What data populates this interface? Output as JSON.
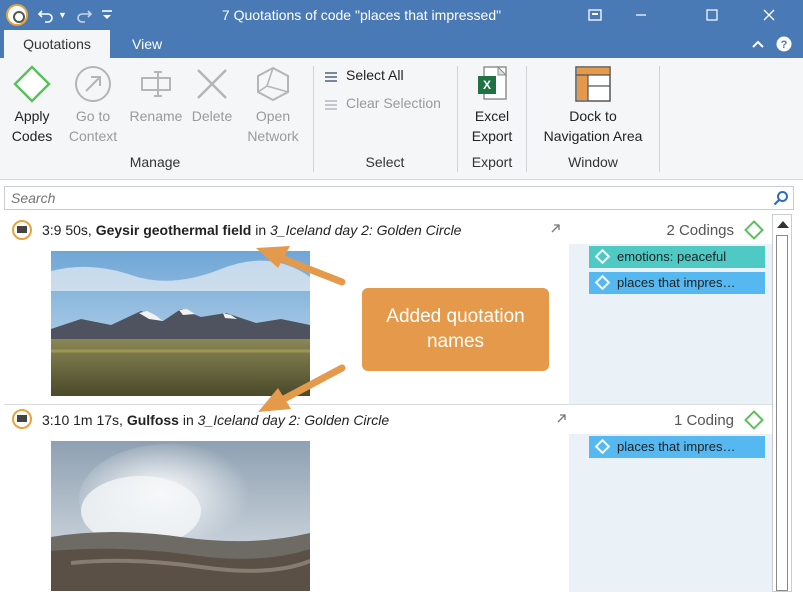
{
  "window": {
    "title": "7 Quotations of code \"places that impressed\""
  },
  "tabs": [
    {
      "label": "Quotations",
      "active": true
    },
    {
      "label": "View",
      "active": false
    }
  ],
  "ribbon": {
    "manage": {
      "label": "Manage",
      "apply_codes": [
        "Apply",
        "Codes"
      ],
      "go_to_context": [
        "Go to",
        "Context"
      ],
      "rename": "Rename",
      "delete": "Delete",
      "open_network": [
        "Open",
        "Network"
      ]
    },
    "select": {
      "label": "Select",
      "select_all": "Select All",
      "clear_selection": "Clear Selection"
    },
    "export": {
      "label": "Export",
      "excel_export": [
        "Excel",
        "Export"
      ]
    },
    "window": {
      "label": "Window",
      "dock": [
        "Dock to",
        "Navigation Area"
      ]
    }
  },
  "search": {
    "placeholder": "Search"
  },
  "quotations": [
    {
      "id": "3:9",
      "duration": "50s,",
      "name": "Geysir geothermal field",
      "in": "in",
      "document": "3_Iceland day 2: Golden Circle",
      "codings_label": "2 Codings",
      "codes": [
        {
          "label": "emotions: peaceful",
          "color": "#4ec9c4"
        },
        {
          "label": "places that impres…",
          "color": "#55b8f0"
        }
      ]
    },
    {
      "id": "3:10",
      "duration": "1m 17s,",
      "name": "Gulfoss",
      "in": "in",
      "document": "3_Iceland day 2: Golden Circle",
      "codings_label": "1 Coding",
      "codes": [
        {
          "label": "places that impres…",
          "color": "#55b8f0"
        }
      ]
    }
  ],
  "callout": {
    "lines": [
      "Added quotation",
      "names"
    ],
    "color": "#e59a4b"
  },
  "colors": {
    "titlebar": "#4a7ab5",
    "ribbon_bg": "#f5f6f7",
    "code_panel": "#eaf1f7",
    "accent_green": "#5cbf5c",
    "quotation_icon": "#e8a33c"
  }
}
